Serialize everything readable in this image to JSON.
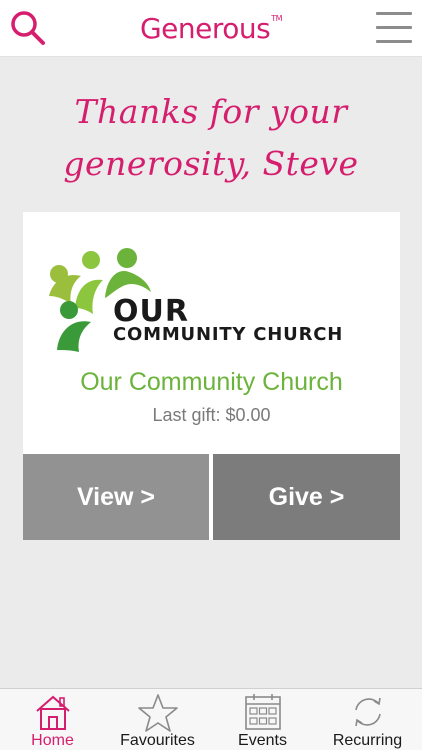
{
  "header": {
    "brand": "Generous",
    "trademark": "TM",
    "search_icon": "search-icon",
    "menu_icon": "hamburger-menu-icon"
  },
  "greeting": {
    "line1": "Thanks for your",
    "line2": "generosity, Steve"
  },
  "card": {
    "logo_word1": "OUR",
    "logo_word2": "COMMUNITY CHURCH",
    "name": "Our Community Church",
    "last_gift_label": "Last gift:",
    "last_gift_amount": "$0.00",
    "view_label": "View >",
    "give_label": "Give >"
  },
  "tabs": [
    {
      "label": "Home",
      "icon": "home-icon",
      "active": true
    },
    {
      "label": "Favourites",
      "icon": "star-icon",
      "active": false
    },
    {
      "label": "Events",
      "icon": "calendar-icon",
      "active": false
    },
    {
      "label": "Recurring",
      "icon": "recurring-icon",
      "active": false
    }
  ],
  "colors": {
    "brand": "#d61e6e",
    "church_green": "#6bb33a",
    "button_view": "#929292",
    "button_give": "#7c7c7c",
    "background": "#ebebeb"
  }
}
